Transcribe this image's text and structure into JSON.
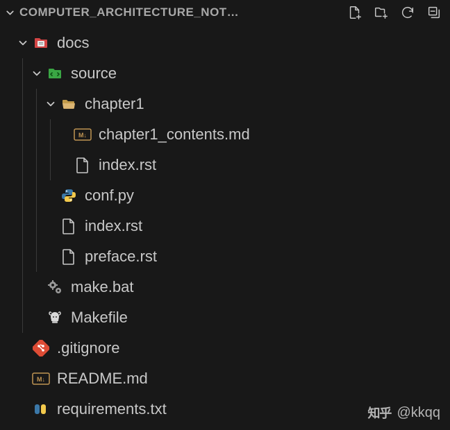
{
  "header": {
    "title": "COMPUTER_ARCHITECTURE_NOT…"
  },
  "tree": {
    "root_docs": "docs",
    "source": "source",
    "chapter1": "chapter1",
    "chapter1_contents": "chapter1_contents.md",
    "chapter1_index": "index.rst",
    "conf_py": "conf.py",
    "source_index": "index.rst",
    "preface": "preface.rst",
    "make_bat": "make.bat",
    "makefile": "Makefile",
    "gitignore": ".gitignore",
    "readme": "README.md",
    "requirements": "requirements.txt"
  },
  "watermark": {
    "logo": "知乎",
    "handle": "@kkqq"
  }
}
